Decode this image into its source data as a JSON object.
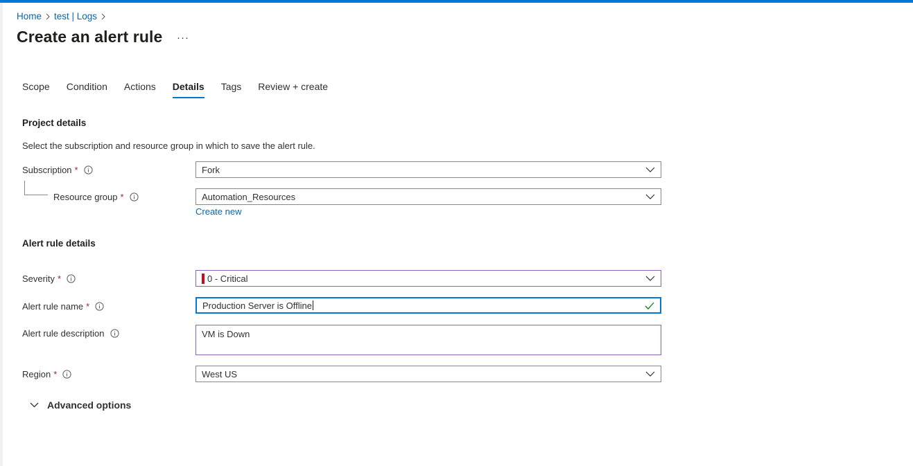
{
  "breadcrumb": {
    "items": [
      "Home",
      "test | Logs"
    ]
  },
  "page": {
    "title": "Create an alert rule",
    "more_label": "···"
  },
  "tabs": [
    {
      "label": "Scope",
      "active": false
    },
    {
      "label": "Condition",
      "active": false
    },
    {
      "label": "Actions",
      "active": false
    },
    {
      "label": "Details",
      "active": true
    },
    {
      "label": "Tags",
      "active": false
    },
    {
      "label": "Review + create",
      "active": false
    }
  ],
  "project_details": {
    "heading": "Project details",
    "description": "Select the subscription and resource group in which to save the alert rule.",
    "subscription": {
      "label": "Subscription",
      "required": "*",
      "value": "Fork"
    },
    "resource_group": {
      "label": "Resource group",
      "required": "*",
      "value": "Automation_Resources"
    },
    "create_new_label": "Create new"
  },
  "alert_rule_details": {
    "heading": "Alert rule details",
    "severity": {
      "label": "Severity",
      "required": "*",
      "value": "0 - Critical",
      "indicator_color": "#c50f1f"
    },
    "rule_name": {
      "label": "Alert rule name",
      "required": "*",
      "value": "Production Server is Offline"
    },
    "rule_description": {
      "label": "Alert rule description",
      "value": "VM is Down"
    },
    "region": {
      "label": "Region",
      "required": "*",
      "value": "West US"
    }
  },
  "advanced": {
    "label": "Advanced options"
  },
  "colors": {
    "accent": "#0078d4",
    "link": "#0067b8",
    "required": "#a4262c",
    "modified_border": "#8764b8",
    "valid_check": "#107c10"
  },
  "icons": {
    "breadcrumb_separator": "chevron-right-icon",
    "info": "info-icon",
    "dropdown": "chevron-down-icon",
    "valid": "checkmark-icon",
    "expand": "chevron-down-icon"
  }
}
